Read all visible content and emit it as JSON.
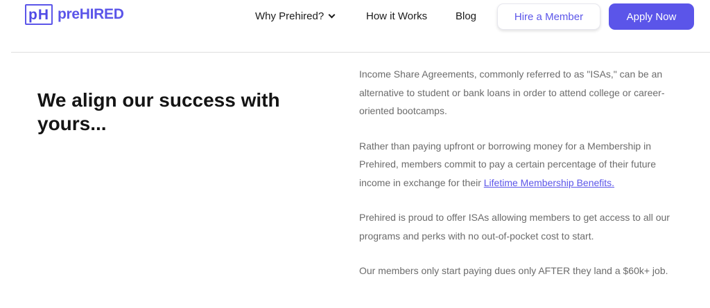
{
  "brand": {
    "logo_mark": "pH",
    "name": "preHIRED",
    "accent_color": "#5b55e9"
  },
  "nav": {
    "why_label": "Why Prehired?",
    "how_label": "How it Works",
    "blog_label": "Blog",
    "hire_label": "Hire a Member",
    "apply_label": "Apply Now"
  },
  "main": {
    "headline": "We align our success with yours...",
    "paragraphs": [
      "Income Share Agreements, commonly referred to as \"ISAs,\" can be an alternative to student or bank loans in order to attend college or career-oriented bootcamps.",
      "Rather than paying upfront or borrowing money for a Membership in Prehired, members commit to pay a certain percentage of their future income in exchange for their ",
      "Prehired is proud to offer ISAs allowing members to get access to all our programs and perks with no out-of-pocket cost to start.",
      "Our members only start paying dues only AFTER they land a $60k+ job."
    ],
    "link_text": "Lifetime Membership Benefits."
  }
}
